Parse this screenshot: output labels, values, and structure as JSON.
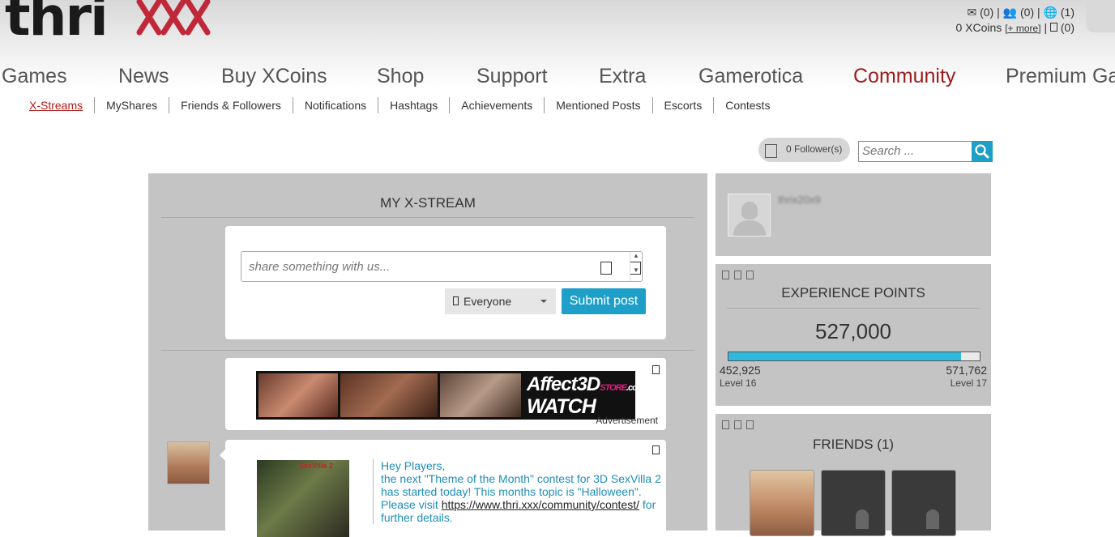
{
  "header": {
    "logo_text": "thri",
    "level_text": "Level 16",
    "messages": "(0)",
    "friend_requests": "(0)",
    "notifications": "(1)",
    "xcoins": "0 XCoins",
    "more_link": "[+ more]",
    "cart": "(0)",
    "sep": "|"
  },
  "main_nav": [
    "Games",
    "News",
    "Buy XCoins",
    "Shop",
    "Support",
    "Extra",
    "Gamerotica",
    "Community",
    "Premium Ga"
  ],
  "sub_nav": [
    "X-Streams",
    "MyShares",
    "Friends & Followers",
    "Notifications",
    "Hashtags",
    "Achievements",
    "Mentioned Posts",
    "Escorts",
    "Contests"
  ],
  "followers": "0 Follower(s)",
  "search": {
    "placeholder": "Search ..."
  },
  "stream": {
    "title": "MY X-STREAM",
    "share_placeholder": "share something with us...",
    "privacy": "Everyone",
    "submit": "Submit post"
  },
  "ad": {
    "brand": "Affect3D",
    "brand_suffix": "STORE",
    "domain": ".com",
    "cta": "WATCH NOW!",
    "label": "Advertisement"
  },
  "post": {
    "img_label": "SexVilla 2",
    "line1": "Hey Players,",
    "line2": "the next \"Theme of the Month\" contest for 3D SexVilla 2 has started today! This months topic is \"Halloween\".",
    "line3_pre": "Please visit ",
    "link": "https://www.thri.xxx/community/contest/",
    "line3_post": " for further details."
  },
  "profile": {
    "name": "thrix20x9"
  },
  "xp": {
    "title": "EXPERIENCE POINTS",
    "value": "527,000",
    "min": "452,925",
    "max": "571,762",
    "progress": 0.926,
    "level_min": "Level 16",
    "level_max": "Level 17"
  },
  "friends": {
    "title": "FRIENDS (1)"
  },
  "colors": {
    "accent": "#1e9fc8",
    "active_nav": "#9b1c1c",
    "xp_fill": "#31b8dd"
  }
}
